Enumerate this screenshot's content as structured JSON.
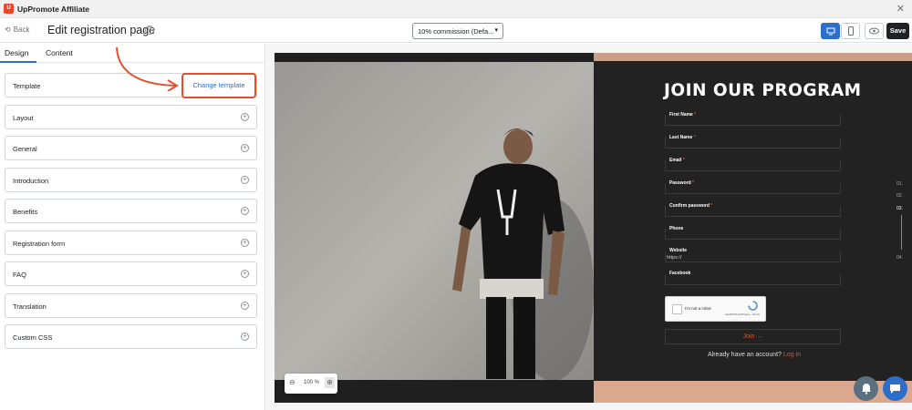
{
  "app": {
    "title": "UpPromote Affiliate"
  },
  "topbar": {
    "back_label": "Back",
    "page_title": "Edit registration page",
    "commission_select": "10% commission (Defa...",
    "save_label": "Save"
  },
  "sidebar": {
    "tabs": [
      {
        "label": "Design"
      },
      {
        "label": "Content"
      }
    ],
    "sections": [
      {
        "label": "Template"
      },
      {
        "label": "Layout"
      },
      {
        "label": "General"
      },
      {
        "label": "Introduction"
      },
      {
        "label": "Benefits"
      },
      {
        "label": "Registration form"
      },
      {
        "label": "FAQ"
      },
      {
        "label": "Translation"
      },
      {
        "label": "Custom CSS"
      }
    ],
    "change_template_label": "Change template"
  },
  "preview": {
    "form_title": "JOIN OUR PROGRAM",
    "fields": [
      {
        "label": "First Name",
        "required": "*"
      },
      {
        "label": "Last Name",
        "required": "*"
      },
      {
        "label": "Email",
        "required": "*"
      },
      {
        "label": "Password",
        "required": "*"
      },
      {
        "label": "Confirm password",
        "required": "*"
      },
      {
        "label": "Phone",
        "required": ""
      },
      {
        "label": "Website",
        "required": ""
      },
      {
        "label": "Facebook",
        "required": ""
      }
    ],
    "website_value": "https://",
    "captcha_text": "I'm not a robot",
    "captcha_brand": "reCAPTCHA\nPrivacy - Terms",
    "join_label": "Join",
    "already_text": "Already have an account?",
    "login_label": "Log in",
    "nav_numbers": [
      "01.",
      "02.",
      "03.",
      "04."
    ],
    "zoom_value": "100 %"
  },
  "colors": {
    "accent": "#2c6ecb",
    "orange": "#e0522f",
    "dark_panel": "#222222"
  }
}
